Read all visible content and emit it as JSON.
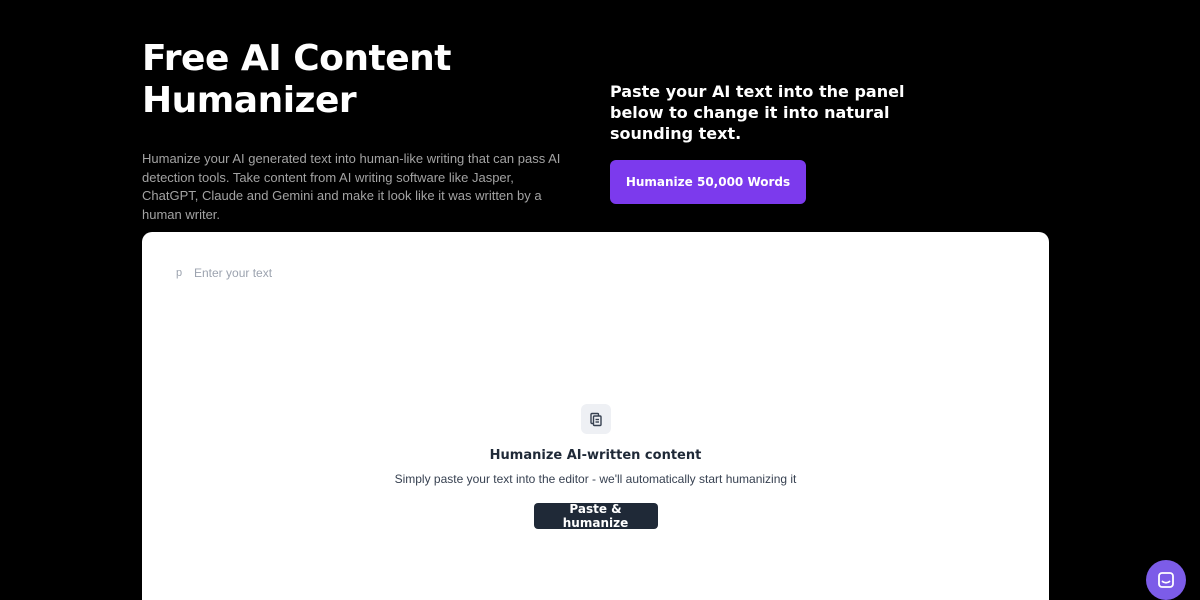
{
  "hero": {
    "title": "Free AI Content Humanizer",
    "description": "Humanize your AI generated text into human-like writing that can pass AI detection tools. Take content from AI writing software like Jasper, ChatGPT, Claude and Gemini and make it look like it was written by a human writer."
  },
  "cta": {
    "tagline": "Paste your AI text into the panel below to change it into natural sounding text.",
    "button_label": "Humanize 50,000 Words"
  },
  "editor": {
    "paragraph_marker": "p",
    "placeholder": "Enter your text",
    "value": "",
    "empty_state": {
      "icon": "clipboard-icon",
      "title": "Humanize AI-written content",
      "subtitle": "Simply paste your text into the editor - we'll automatically start humanizing it",
      "button_label": "Paste & humanize"
    }
  },
  "chat": {
    "icon": "chat-icon"
  },
  "colors": {
    "background": "#000000",
    "accent": "#7c3aed",
    "chat_accent": "#7c5ce8",
    "dark_button": "#1f2937",
    "panel": "#ffffff"
  }
}
